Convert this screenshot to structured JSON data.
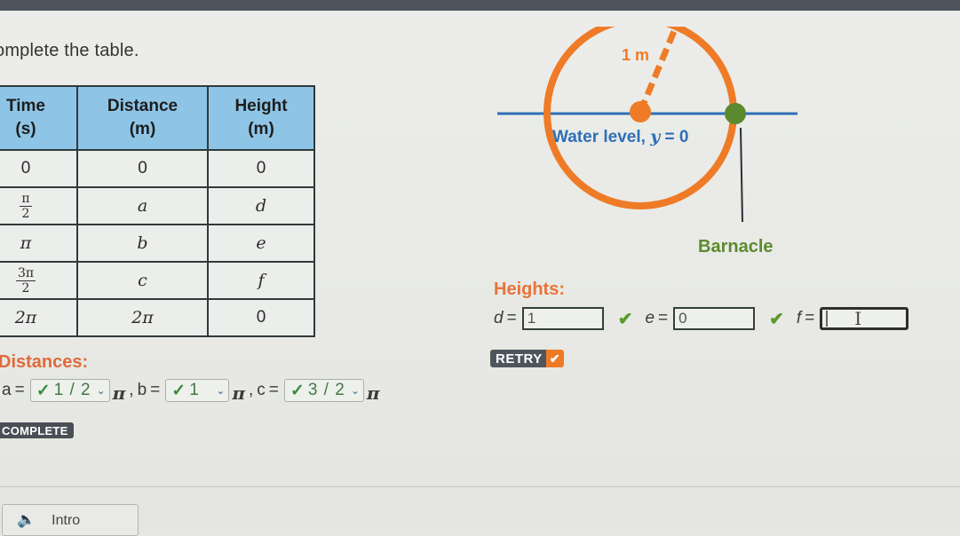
{
  "instruction": "omplete the table.",
  "table": {
    "headers": [
      {
        "line1": "Time",
        "line2": "(s)"
      },
      {
        "line1": "Distance",
        "line2": "(m)"
      },
      {
        "line1": "Height",
        "line2": "(m)"
      }
    ],
    "rows": [
      {
        "time": "0",
        "distance": "0",
        "height": "0"
      },
      {
        "time_num": "π",
        "time_den": "2",
        "distance": "a",
        "height": "d"
      },
      {
        "time": "π",
        "distance": "b",
        "height": "e"
      },
      {
        "time_num": "3π",
        "time_den": "2",
        "distance": "c",
        "height": "f"
      },
      {
        "time": "2π",
        "distance": "2π",
        "height": "0"
      }
    ]
  },
  "diagram": {
    "radius_label": "1 m",
    "water_label": "Water level, ",
    "water_var": "y",
    "water_eq": " = 0",
    "barnacle_label": "Barnacle",
    "colors": {
      "wheel": "#ef7b27",
      "water": "#2f6fb6",
      "barnacle": "#5b8a2e",
      "water_text": "#2f6fb6"
    }
  },
  "heights": {
    "label": "Heights:",
    "d": {
      "var": "d",
      "value": "1",
      "correct": true
    },
    "e": {
      "var": "e",
      "value": "0",
      "correct": true
    },
    "f": {
      "var": "f",
      "value": "",
      "active": true
    }
  },
  "retry": {
    "label": "RETRY",
    "icon": "✔"
  },
  "distances": {
    "label": "Distances:",
    "a": {
      "var": "a",
      "value": "1 / 2"
    },
    "b": {
      "var": "b",
      "value": "1  "
    },
    "c": {
      "var": "c",
      "value": "3 / 2"
    },
    "check": "✓",
    "chevron": "⌄",
    "pi": "π"
  },
  "complete_badge": "COMPLETE",
  "footer": {
    "intro_label": "Intro",
    "intro_icon": "🔈"
  },
  "symbols": {
    "equals": "=",
    "comma": ",",
    "check": "✔",
    "ibeam": "I"
  }
}
